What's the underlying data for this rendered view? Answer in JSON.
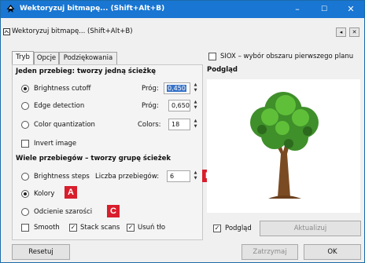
{
  "window": {
    "title": "Wektoryzuj bitmapę... (Shift+Alt+B)",
    "min": "–",
    "max": "☐",
    "close": "✕"
  },
  "dialog": {
    "title": "Wektoryzuj bitmapę... (Shift+Alt+B)",
    "btn_a": "◂",
    "btn_b": "✕"
  },
  "tabs": [
    "Tryb",
    "Opcje",
    "Podziękowania"
  ],
  "single": {
    "heading": "Jeden przebieg: tworzy jedną ścieżkę",
    "options": [
      {
        "label": "Brightness cutoff",
        "param": "Próg:",
        "value": "0,450",
        "selected": true
      },
      {
        "label": "Edge detection",
        "param": "Próg:",
        "value": "0,650"
      },
      {
        "label": "Color quantization",
        "param": "Colors:",
        "value": "18"
      }
    ],
    "invert": "Invert image"
  },
  "multi": {
    "heading": "Wiele przebiegów – tworzy grupę ścieżek",
    "options": [
      "Brightness steps",
      "Kolory",
      "Odcienie szarości"
    ],
    "scans_label": "Liczba przebiegów:",
    "scans_value": "6",
    "smooth": "Smooth",
    "stack": "Stack scans",
    "remove_bg": "Usuń tło"
  },
  "badges": {
    "a": "A",
    "b": "B",
    "c": "C"
  },
  "right": {
    "siox": "SIOX – wybór obszaru pierwszego planu",
    "preview_heading": "Podgląd",
    "preview_check": "Podgląd",
    "refresh": "Aktualizuj"
  },
  "footer": {
    "reset": "Resetuj",
    "stop": "Zatrzymaj",
    "ok": "OK"
  },
  "colors": {
    "titlebar": "#1976d2",
    "badge": "#d81e2c",
    "selection": "#3873c8"
  }
}
